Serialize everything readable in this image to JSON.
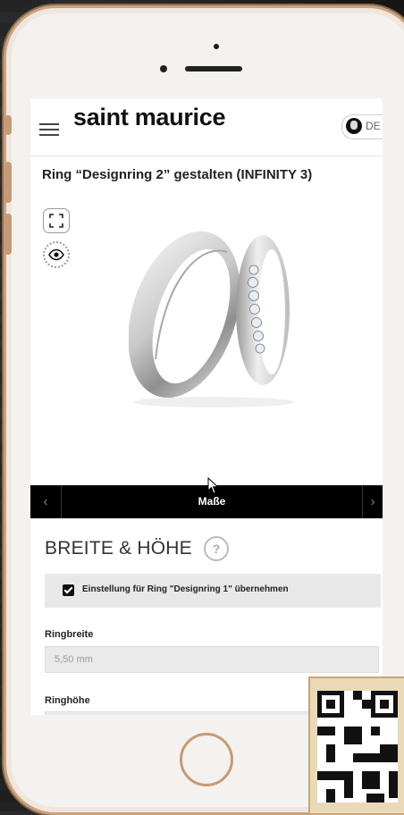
{
  "brand": {
    "name": "saint maurice"
  },
  "header": {
    "language": "DE"
  },
  "page": {
    "title": "Ring “Designring 2” gestalten  (INFINITY 3)"
  },
  "icons": {
    "menu": "hamburger-icon",
    "language": "globe-icon",
    "fullscreen": "fullscreen-icon",
    "view": "eye-icon",
    "help": "help-icon"
  },
  "tabs": {
    "current": "Maße",
    "prev_arrow": "‹",
    "next_arrow": "›"
  },
  "section": {
    "title": "BREITE & HÖHE",
    "help_symbol": "?"
  },
  "option": {
    "label": "Einstellung für Ring \"Designring 1\" übernehmen",
    "checked": true
  },
  "fields": [
    {
      "label": "Ringbreite",
      "value": "5,50 mm"
    },
    {
      "label": "Ringhöhe",
      "value": ""
    }
  ],
  "colors": {
    "phone_frame": "#caa27e",
    "navbar_bg": "#000000",
    "field_bg": "#eaeaea"
  }
}
